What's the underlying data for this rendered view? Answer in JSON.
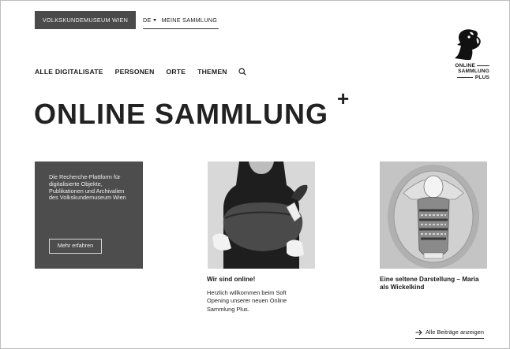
{
  "top_bar": {
    "museum_button": "VOLKSKUNDEMUSEUM WIEN",
    "language": "DE",
    "my_collection": "MEINE SAMMLUNG"
  },
  "logo": {
    "line1": "ONLINE",
    "line2": "SAMMLUNG",
    "line3": "PLUS",
    "icon": "bird-head-logo-icon"
  },
  "nav": {
    "items": [
      "ALLE DIGITALISATE",
      "PERSONEN",
      "ORTE",
      "THEMEN"
    ],
    "search_icon": "search-icon"
  },
  "hero": {
    "title": "ONLINE SAMMLUNG",
    "plus": "+"
  },
  "intro_card": {
    "text": "Die Recherche-Plattform für digitalisierte Objekte, Publikationen und Archivalien des Volkskundemuseum Wien",
    "button": "Mehr erfahren"
  },
  "posts": [
    {
      "title": "Wir sind online!",
      "text": "Herzlich willkommen beim Soft Opening unserer neuen Online Sammlung Plus."
    },
    {
      "title": "Eine seltene Darstellung – Maria als Wickelkind"
    }
  ],
  "all_posts_link": "Alle Beiträge anzeigen",
  "colors": {
    "dark_panel": "#4d4d4d",
    "text": "#1a1a1a",
    "background": "#ffffff"
  }
}
